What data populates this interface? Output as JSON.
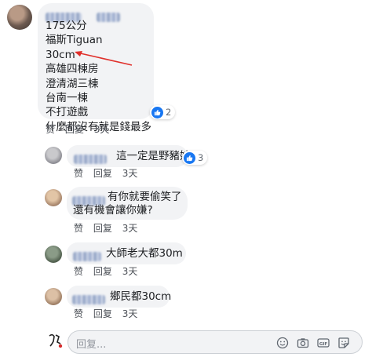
{
  "main_comment": {
    "lines": [
      "175公分",
      "福斯Tiguan",
      "30cm",
      "高雄四棟房",
      "澄清湖三棟",
      "台南一棟",
      "不打遊戲",
      "什麼都沒有就是錢最多"
    ],
    "reaction_count": "2",
    "actions": {
      "like": "赞",
      "reply": "回复",
      "time": "3天"
    }
  },
  "replies": [
    {
      "text": "這一定是野豬妹",
      "reaction_count": "3",
      "actions": {
        "like": "赞",
        "reply": "回复",
        "time": "3天"
      }
    },
    {
      "lines": [
        "有你就要偷笑了",
        "還有機會讓你嫌?"
      ],
      "actions": {
        "like": "赞",
        "reply": "回复",
        "time": "3天"
      }
    },
    {
      "text": "大師老大都30m",
      "actions": {
        "like": "赞",
        "reply": "回复",
        "time": "3天"
      }
    },
    {
      "text": "鄉民都30cm",
      "actions": {
        "like": "赞",
        "reply": "回复",
        "time": "3天"
      }
    }
  ],
  "reply_box": {
    "placeholder": "回复...",
    "icons": [
      "emoji-icon",
      "camera-icon",
      "gif-icon",
      "sticker-icon"
    ]
  },
  "colors": {
    "bubble": "#f2f3f5",
    "like_blue": "#1877f2",
    "arrow_red": "#e0302b",
    "meta_text": "#4b4f56"
  }
}
